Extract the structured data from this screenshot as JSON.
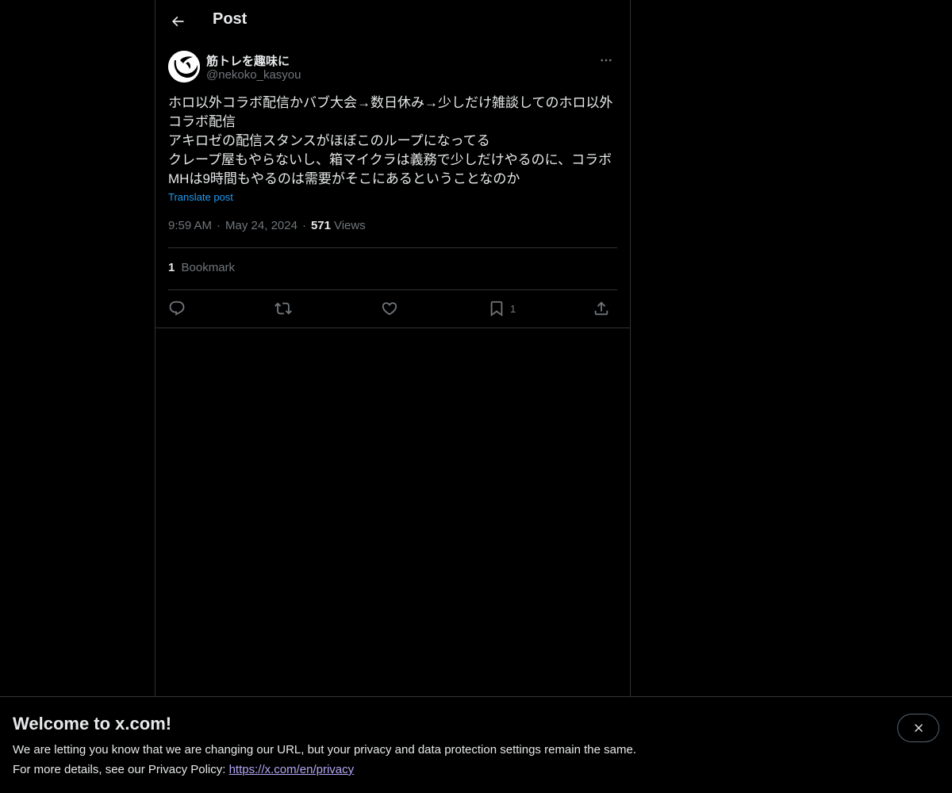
{
  "header": {
    "title": "Post",
    "back_icon": "arrow-left-icon"
  },
  "author": {
    "display_name": "筋トレを趣味に",
    "handle": "@nekoko_kasyou",
    "avatar_icon": "avatar-image",
    "more_icon": "more-horizontal-icon"
  },
  "tweet": {
    "text": "ホロ以外コラボ配信かバブ大会→数日休み→少しだけ雑談してのホロ以外コラボ配信\nアキロゼの配信スタンスがほぼこのループになってる\nクレープ屋もやらないし、箱マイクラは義務で少しだけやるのに、コラボMHは9時間もやるのは需要がそこにあるということなのか",
    "translate_label": "Translate post",
    "time": "9:59 AM",
    "separator": "·",
    "date": "May 24, 2024",
    "views_count": "571",
    "views_label": "Views"
  },
  "stats": {
    "bookmark_count": "1",
    "bookmark_label": "Bookmark"
  },
  "actions": {
    "reply_icon": "reply-icon",
    "repost_icon": "repost-icon",
    "like_icon": "like-icon",
    "bookmark_icon": "bookmark-icon",
    "bookmark_count": "1",
    "share_icon": "share-icon"
  },
  "banner": {
    "title": "Welcome to x.com!",
    "line1": "We are letting you know that we are changing our URL, but your privacy and data protection settings remain the same.",
    "line2_prefix": "For more details, see our Privacy Policy: ",
    "link_text": "https://x.com/en/privacy",
    "close_icon": "close-icon"
  },
  "colors": {
    "background": "#000000",
    "text_primary": "#e7e9ea",
    "text_secondary": "#71767b",
    "accent": "#1d9bf0",
    "link_purple": "#b4a7f5",
    "border": "#2f3336"
  }
}
